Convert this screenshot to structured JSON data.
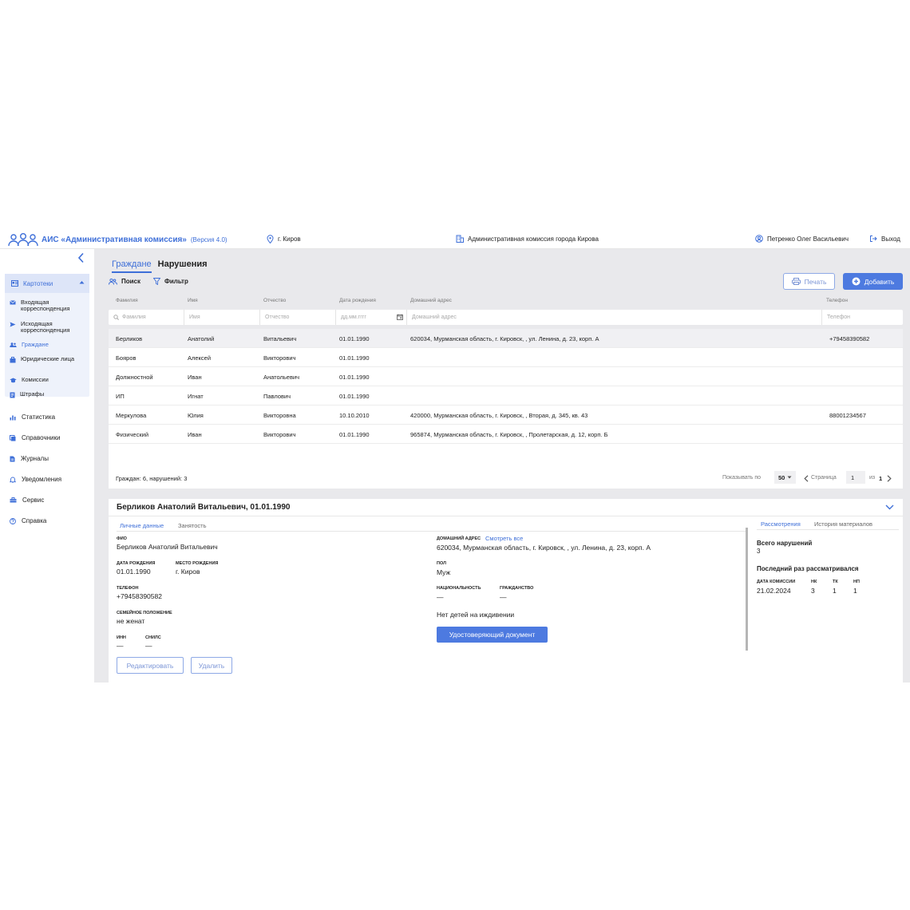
{
  "app": {
    "title": "АИС «Административная комиссия»",
    "version": "(Версия 4.0)",
    "city": "г. Киров",
    "organization": "Административная комиссия города Кирова",
    "user": "Петренко Олег Васильевич",
    "logout": "Выход"
  },
  "sidebar": {
    "group_label": "Картотеки",
    "group_items": [
      {
        "label": "Входящая корреспонденция",
        "icon": "mail-icon"
      },
      {
        "label": "Исходящая корреспонденция",
        "icon": "send-icon"
      },
      {
        "label": "Граждане",
        "icon": "people-icon"
      },
      {
        "label": "Юридические лица",
        "icon": "briefcase-icon"
      },
      {
        "label": "Комиссии",
        "icon": "graduation-cap-icon"
      },
      {
        "label": "Штрафы",
        "icon": "receipt-icon"
      }
    ],
    "items": [
      {
        "label": "Статистика",
        "icon": "bar-chart-icon"
      },
      {
        "label": "Справочники",
        "icon": "books-icon"
      },
      {
        "label": "Журналы",
        "icon": "document-icon"
      },
      {
        "label": "Уведомления",
        "icon": "bell-icon"
      },
      {
        "label": "Сервис",
        "icon": "toolbox-icon"
      },
      {
        "label": "Справка",
        "icon": "help-icon"
      }
    ]
  },
  "main": {
    "tabs": [
      "Граждане",
      "Нарушения"
    ],
    "toolbar": {
      "search": "Поиск",
      "filter": "Фильтр",
      "print": "Печать",
      "add": "Добавить"
    },
    "columns": [
      "Фамилия",
      "Имя",
      "Отчество",
      "Дата рождения",
      "Домашний адрес",
      "Телефон"
    ],
    "filters": {
      "lastname": "Фамилия",
      "firstname": "Имя",
      "patronymic": "Отчество",
      "birthdate": "дд.мм.гггг",
      "address": "Домашний адрес",
      "phone": "Телефон"
    },
    "rows": [
      {
        "lastname": "Берликов",
        "firstname": "Анатолий",
        "patronymic": "Витальевич",
        "birthdate": "01.01.1990",
        "address": "620034, Мурманская область, г. Кировск, , ул. Ленина, д. 23, корп. А",
        "phone": "+79458390582"
      },
      {
        "lastname": "Бояров",
        "firstname": "Алексей",
        "patronymic": "Викторович",
        "birthdate": "01.01.1990",
        "address": "",
        "phone": ""
      },
      {
        "lastname": "Должностной",
        "firstname": "Иван",
        "patronymic": "Анатольевич",
        "birthdate": "01.01.1990",
        "address": "",
        "phone": ""
      },
      {
        "lastname": "ИП",
        "firstname": "Игнат",
        "patronymic": "Павлович",
        "birthdate": "01.01.1990",
        "address": "",
        "phone": ""
      },
      {
        "lastname": "Меркулова",
        "firstname": "Юлия",
        "patronymic": "Викторовна",
        "birthdate": "10.10.2010",
        "address": "420000, Мурманская область, г. Кировск, , Вторая, д. 345, кв. 43",
        "phone": "88001234567"
      },
      {
        "lastname": "Физический",
        "firstname": "Иван",
        "patronymic": "Викторович",
        "birthdate": "01.01.1990",
        "address": "965874, Мурманская область, г. Кировск, , Пролетарская, д. 12, корп. Б",
        "phone": ""
      }
    ],
    "footer": {
      "summary": "Граждан: 6, нарушений: 3",
      "show_label": "Показывать по",
      "page_size": "50",
      "page_label": "Страница",
      "page": "1",
      "of_label": "из",
      "total_pages": "1"
    }
  },
  "detail": {
    "title": "Берликов Анатолий Витальевич, 01.01.1990",
    "tabs": [
      "Личные данные",
      "Занятость"
    ],
    "right_tabs": [
      "Рассмотрения",
      "История материалов"
    ],
    "fio_label": "ФИО",
    "fio": "Берликов Анатолий Витальевич",
    "birthdate_label": "Дата рождения",
    "birthdate": "01.01.1990",
    "birthplace_label": "Место рождения",
    "birthplace": "г. Киров",
    "phone_label": "Телефон",
    "phone": "+79458390582",
    "marital_label": "Семейное положение",
    "marital": "не женат",
    "inn_label": "ИНН",
    "inn": "—",
    "snils_label": "СНИЛС",
    "snils": "—",
    "address_label": "Домашний адрес",
    "address_link": "Смотреть все",
    "address": "620034, Мурманская область, г. Кировск, , ул. Ленина, д. 23, корп. А",
    "gender_label": "Пол",
    "gender": "Муж",
    "nationality_label": "Национальность",
    "nationality": "—",
    "citizenship_label": "Гражданство",
    "citizenship": "—",
    "children": "Нет детей на иждивении",
    "doc_button": "Удостоверяющий документ",
    "edit_button": "Редактировать",
    "delete_button": "Удалить",
    "violations_total_label": "Всего нарушений",
    "violations_total": "3",
    "last_review_label": "Последний раз рассматривался",
    "commission_date_label": "Дата комиссии",
    "commission_date": "21.02.2024",
    "nk_label": "НК",
    "nk": "3",
    "tk_label": "ТК",
    "tk": "1",
    "np_label": "НП",
    "np": "1"
  }
}
